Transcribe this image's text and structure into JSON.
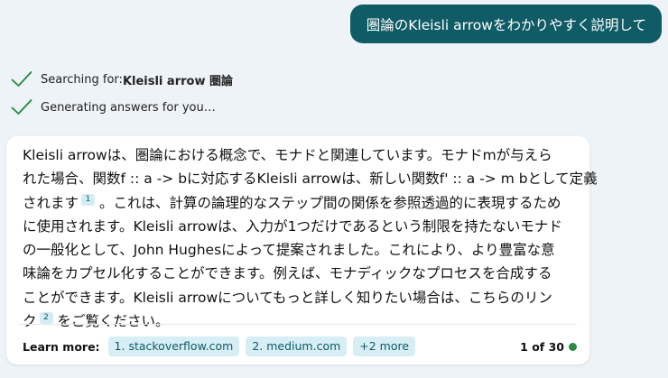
{
  "user_message": "圏論のKleisli arrowをわかりやすく説明して",
  "status": {
    "searching_prefix": "Searching for: ",
    "searching_query": "Kleisli arrow 圏論",
    "generating": "Generating answers for you…"
  },
  "answer": {
    "lines": [
      "Kleisli arrowは、圏論における概念で、モナドと関連しています。モナドmが与えら",
      "れた場合、関数f :: a -> bに対応するKleisli arrowは、新しい関数f' :: a -> m bとして定義",
      "されます",
      "。これは、計算の論理的なステップ間の関係を参照透過的に表現するため",
      "に使用されます。Kleisli arrowは、入力が1つだけであるという制限を持たないモナド",
      "の一般化として、John Hughesによって提案されました。これにより、より豊富な意",
      "味論をカプセル化することができます。例えば、モナディックなプロセスを合成する",
      "ことができます。Kleisli arrowについてもっと詳しく知りたい場合は、こちらのリン",
      "ク",
      "をご覧ください。"
    ],
    "citations": [
      "1",
      "2"
    ]
  },
  "learn_more": {
    "label": "Learn more:",
    "links": [
      "1. stackoverflow.com",
      "2. medium.com",
      "+2 more"
    ]
  },
  "pagination": {
    "text": "1 of 30"
  },
  "colors": {
    "accent": "#0f5b66",
    "check": "#1e8c3a",
    "status_dot": "#2e8b45"
  }
}
